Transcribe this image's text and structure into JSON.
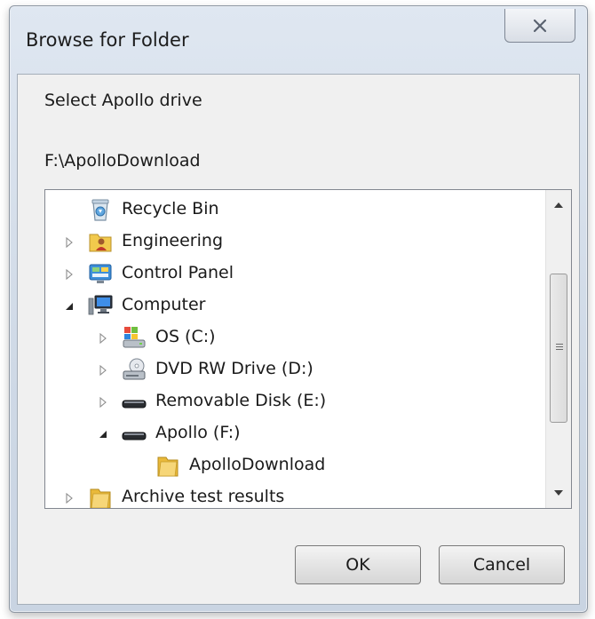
{
  "window": {
    "title": "Browse for Folder"
  },
  "dialog": {
    "prompt": "Select Apollo drive",
    "selected_path": "F:\\ApolloDownload"
  },
  "tree": {
    "items": [
      {
        "label": "Recycle Bin",
        "icon": "recycle-bin-icon",
        "expander": "none"
      },
      {
        "label": "Engineering",
        "icon": "user-folder-icon",
        "expander": "collapsed"
      },
      {
        "label": "Control Panel",
        "icon": "control-panel-icon",
        "expander": "collapsed"
      },
      {
        "label": "Computer",
        "icon": "computer-icon",
        "expander": "expanded"
      },
      {
        "label": "OS (C:)",
        "icon": "system-drive-icon",
        "expander": "collapsed"
      },
      {
        "label": "DVD RW Drive (D:)",
        "icon": "dvd-drive-icon",
        "expander": "collapsed"
      },
      {
        "label": "Removable Disk (E:)",
        "icon": "removable-disk-icon",
        "expander": "collapsed"
      },
      {
        "label": "Apollo (F:)",
        "icon": "removable-disk-icon",
        "expander": "expanded"
      },
      {
        "label": "ApolloDownload",
        "icon": "folder-icon",
        "expander": "none"
      },
      {
        "label": "Archive test results",
        "icon": "folder-icon",
        "expander": "collapsed"
      }
    ]
  },
  "buttons": {
    "ok": "OK",
    "cancel": "Cancel"
  }
}
